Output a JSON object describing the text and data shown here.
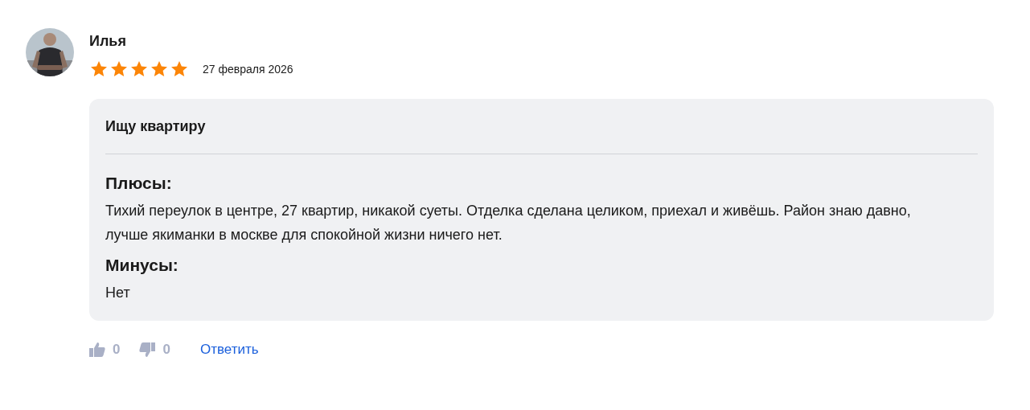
{
  "review": {
    "author": "Илья",
    "stars": 5,
    "date": "27 февраля 2026",
    "title": "Ищу квартиру",
    "sections": [
      {
        "heading": "Плюсы:",
        "text": "Тихий переулок в центре, 27 квартир, никакой суеты. Отделка сделана целиком, приехал и живёшь. Район знаю давно, лучше якиманки в москве для спокойной жизни ничего нет."
      },
      {
        "heading": "Минусы:",
        "text": "Нет"
      }
    ],
    "likes": "0",
    "dislikes": "0",
    "reply": "Ответить"
  }
}
